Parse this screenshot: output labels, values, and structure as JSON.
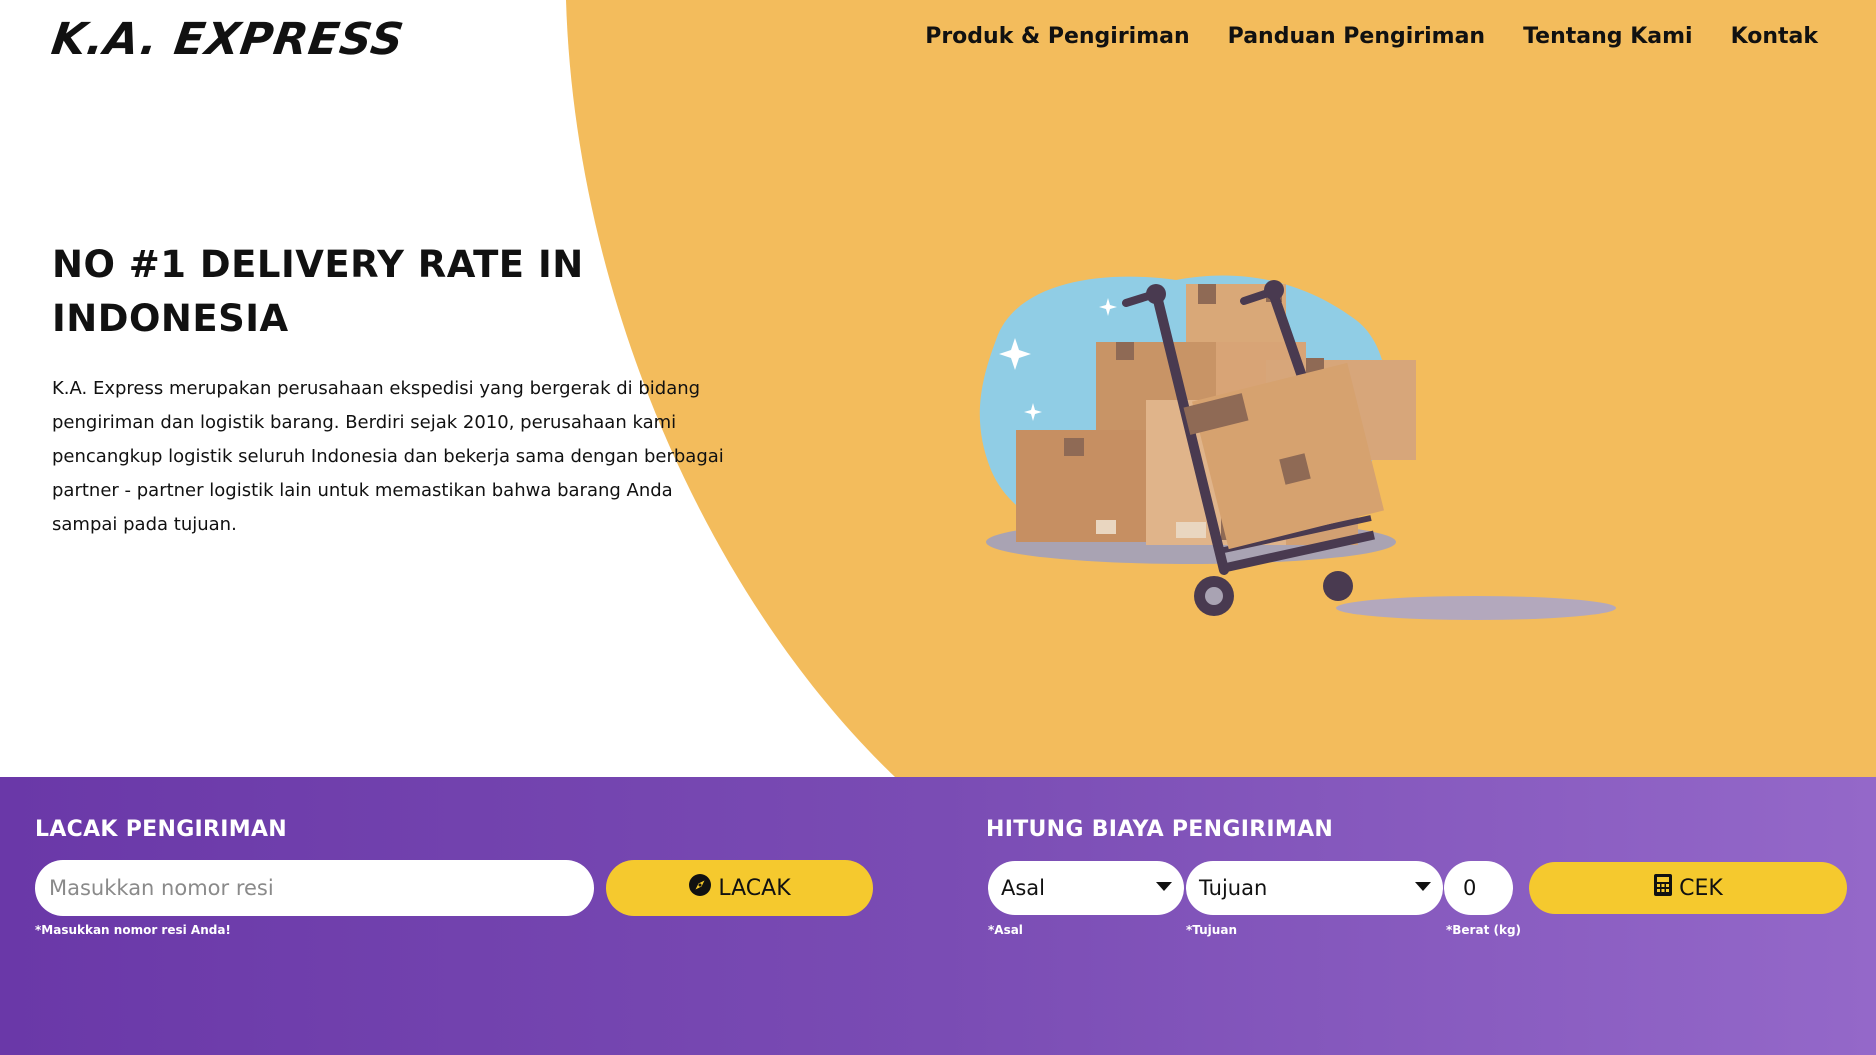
{
  "brand": {
    "logo": "K.A. EXPRESS"
  },
  "nav": {
    "items": [
      {
        "label": "Produk & Pengiriman"
      },
      {
        "label": "Panduan Pengiriman"
      },
      {
        "label": "Tentang Kami"
      },
      {
        "label": "Kontak"
      }
    ]
  },
  "hero": {
    "title": "NO #1 DELIVERY RATE IN INDONESIA",
    "description": "K.A. Express merupakan perusahaan ekspedisi yang bergerak di bidang pengiriman dan logistik barang. Berdiri sejak 2010, perusahaan kami pencangkup logistik seluruh Indonesia dan bekerja sama dengan berbagai partner - partner logistik lain untuk memastikan bahwa barang Anda sampai pada tujuan.",
    "illustration_icon": "boxes-hand-truck-illustration"
  },
  "tracking": {
    "title": "LACAK PENGIRIMAN",
    "input_placeholder": "Masukkan nomor resi",
    "input_value": "",
    "button_label": "LACAK",
    "button_icon": "compass-icon",
    "hint": "*Masukkan nomor resi Anda!"
  },
  "cost": {
    "title": "HITUNG BIAYA PENGIRIMAN",
    "origin": {
      "value": "Asal",
      "hint": "*Asal"
    },
    "destination": {
      "value": "Tujuan",
      "hint": "*Tujuan"
    },
    "weight": {
      "value": "0",
      "hint": "*Berat (kg)"
    },
    "button_label": "CEK",
    "button_icon": "calculator-icon"
  },
  "colors": {
    "hero_accent": "#f3bc5c",
    "footer_gradient_start": "#6a38a8",
    "footer_gradient_end": "#9468c9",
    "button": "#f5c92e"
  }
}
